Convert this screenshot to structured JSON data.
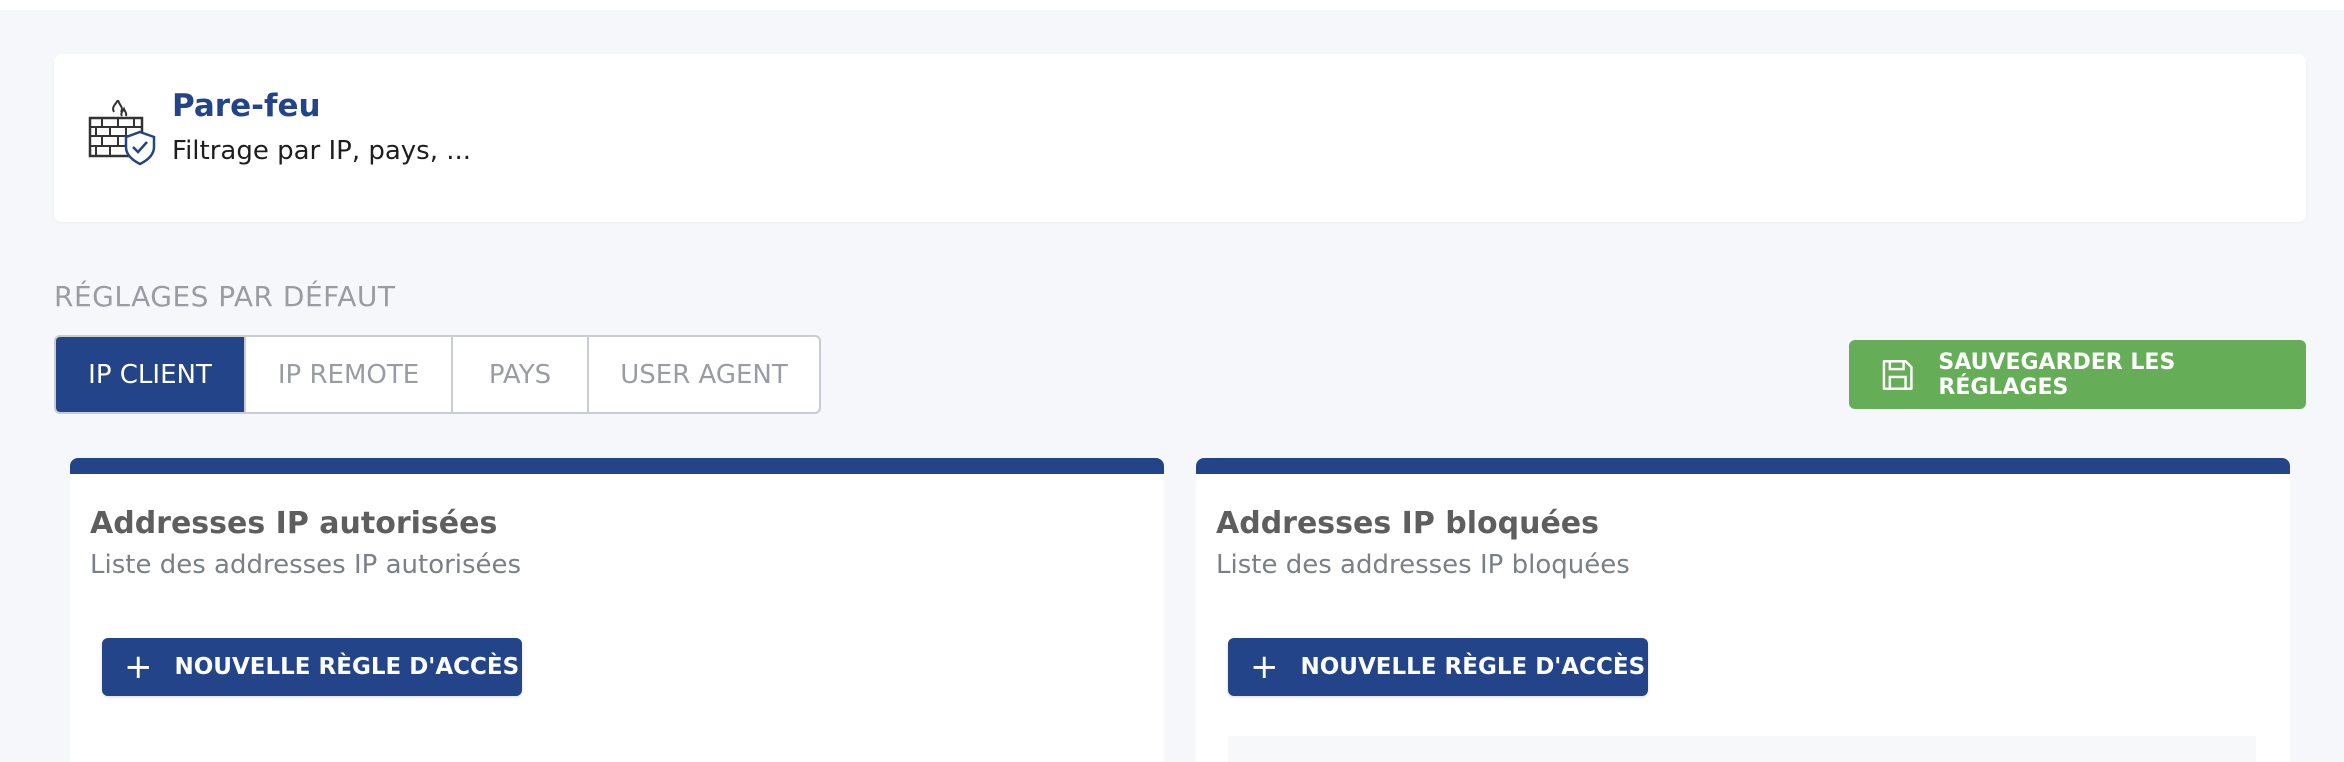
{
  "header": {
    "title": "Pare-feu",
    "subtitle": "Filtrage par IP, pays, ...",
    "icon": "firewall-icon"
  },
  "settings": {
    "section_label": "RÉGLAGES PAR DÉFAUT",
    "tabs": [
      {
        "label": "IP CLIENT",
        "active": true
      },
      {
        "label": "IP REMOTE",
        "active": false
      },
      {
        "label": "PAYS",
        "active": false
      },
      {
        "label": "USER AGENT",
        "active": false
      }
    ],
    "save_label": "SAUVEGARDER LES RÉGLAGES"
  },
  "panels": {
    "allowed": {
      "title": "Addresses IP autorisées",
      "subtitle": "Liste des addresses IP autorisées",
      "button_label": "NOUVELLE RÈGLE D'ACCÈS"
    },
    "blocked": {
      "title": "Addresses IP bloquées",
      "subtitle": "Liste des addresses IP bloquées",
      "button_label": "NOUVELLE RÈGLE D'ACCÈS"
    }
  },
  "colors": {
    "primary": "#234488",
    "success": "#66ad58",
    "muted": "#999da3",
    "background": "#f5f7fb"
  }
}
